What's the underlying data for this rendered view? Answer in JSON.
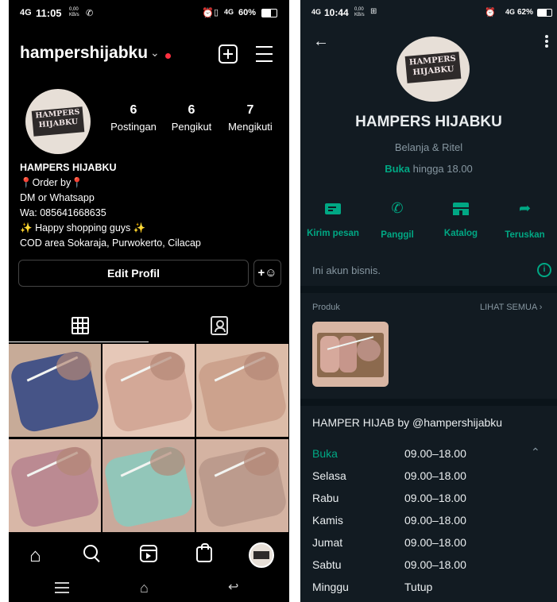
{
  "instagram": {
    "status_bar": {
      "network": "4G",
      "time": "11:05",
      "data_rate": "0,00 KB/s",
      "battery": "60%"
    },
    "username": "hampershijabku",
    "avatar_text": "HAMPERS HIJABKU",
    "stats": [
      {
        "value": "6",
        "label": "Postingan"
      },
      {
        "value": "6",
        "label": "Pengikut"
      },
      {
        "value": "7",
        "label": "Mengikuti"
      }
    ],
    "bio": {
      "name": "HAMPERS HIJABKU",
      "line1": "Order by",
      "line2": "DM or Whatsapp",
      "line3": "Wa:  085641668635",
      "line4": "Happy shopping guys",
      "line5": "COD area Sokaraja, Purwokerto, Cilacap"
    },
    "edit_profile_label": "Edit Profil",
    "posts": [
      {
        "fabric": "#3f4f86",
        "base": "#c7ab98"
      },
      {
        "fabric": "#d2a795",
        "base": "#e6c8b8"
      },
      {
        "fabric": "#caa08b",
        "base": "#dcbca8"
      },
      {
        "fabric": "#b98790",
        "base": "#d8b7a7"
      },
      {
        "fabric": "#8fc7bb",
        "base": "#c9a99b"
      },
      {
        "fabric": "#ba9a8c",
        "base": "#d4b3a2"
      }
    ]
  },
  "whatsapp": {
    "status_bar": {
      "network": "4G",
      "time": "10:44",
      "data_rate": "0,00 KB/s",
      "battery": "62%"
    },
    "avatar_text": "HAMPERS HIJABKU",
    "business_name": "HAMPERS HIJABKU",
    "category": "Belanja & Ritel",
    "open_status": "Buka",
    "open_until": "hingga 18.00",
    "actions": [
      {
        "icon": "message-icon",
        "label": "Kirim pesan"
      },
      {
        "icon": "phone-icon",
        "label": "Panggil"
      },
      {
        "icon": "store-icon",
        "label": "Katalog"
      },
      {
        "icon": "forward-icon",
        "label": "Teruskan"
      }
    ],
    "business_note": "Ini akun bisnis.",
    "products_label": "Produk",
    "see_all_label": "LIHAT SEMUA",
    "description": "HAMPER HIJAB by @hampershijabku",
    "hours": [
      {
        "day": "Buka",
        "time": "09.00–18.00"
      },
      {
        "day": "Selasa",
        "time": "09.00–18.00"
      },
      {
        "day": "Rabu",
        "time": "09.00–18.00"
      },
      {
        "day": "Kamis",
        "time": "09.00–18.00"
      },
      {
        "day": "Jumat",
        "time": "09.00–18.00"
      },
      {
        "day": "Sabtu",
        "time": "09.00–18.00"
      },
      {
        "day": "Minggu",
        "time": "Tutup"
      }
    ],
    "accent_color": "#00a884"
  }
}
